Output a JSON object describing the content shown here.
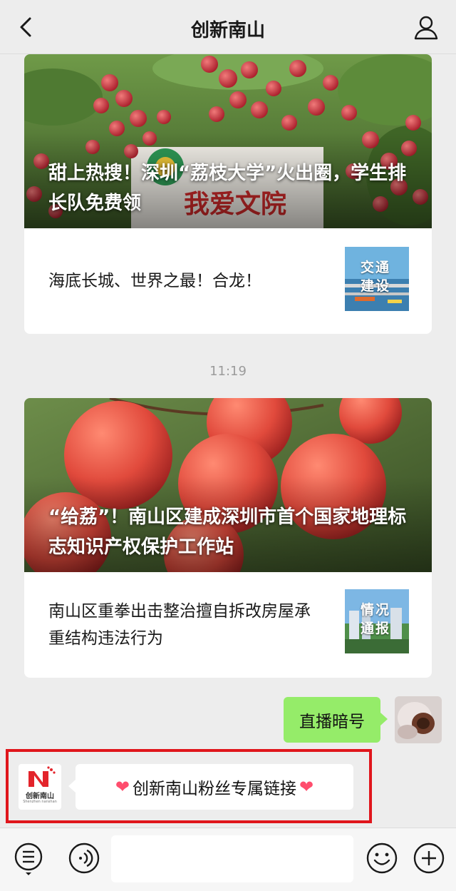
{
  "header": {
    "title": "创新南山",
    "back_icon": "chevron-left-icon",
    "profile_icon": "person-icon"
  },
  "articles": [
    {
      "headline": "甜上热搜！深圳“荔枝大学”火出圈，学生排长队免费领",
      "sub": {
        "text": "海底长城、世界之最！合龙！",
        "thumb_label": "交通建设"
      }
    },
    {
      "headline": "“给荔”！南山区建成深圳市首个国家地理标志知识产权保护工作站",
      "sub": {
        "text": "南山区重拳出击整治擅自拆改房屋承重结构违法行为",
        "thumb_label": "情况通报"
      }
    }
  ],
  "timestamp": "11:19",
  "messages": {
    "outgoing": "直播暗号",
    "incoming": "创新南山粉丝专属链接",
    "incoming_decoration": "heart-emoji"
  },
  "official_avatar": {
    "logo_text": "创新南山",
    "logo_sub": "Shenzhen nanshan"
  },
  "bottom_bar": {
    "menu_icon": "list-menu-icon",
    "voice_icon": "voice-icon",
    "emoji_icon": "emoji-icon",
    "add_icon": "plus-icon",
    "input_value": ""
  },
  "colors": {
    "bubble_outgoing": "#95ec69",
    "highlight_border": "#e0161c",
    "background": "#ededed"
  }
}
